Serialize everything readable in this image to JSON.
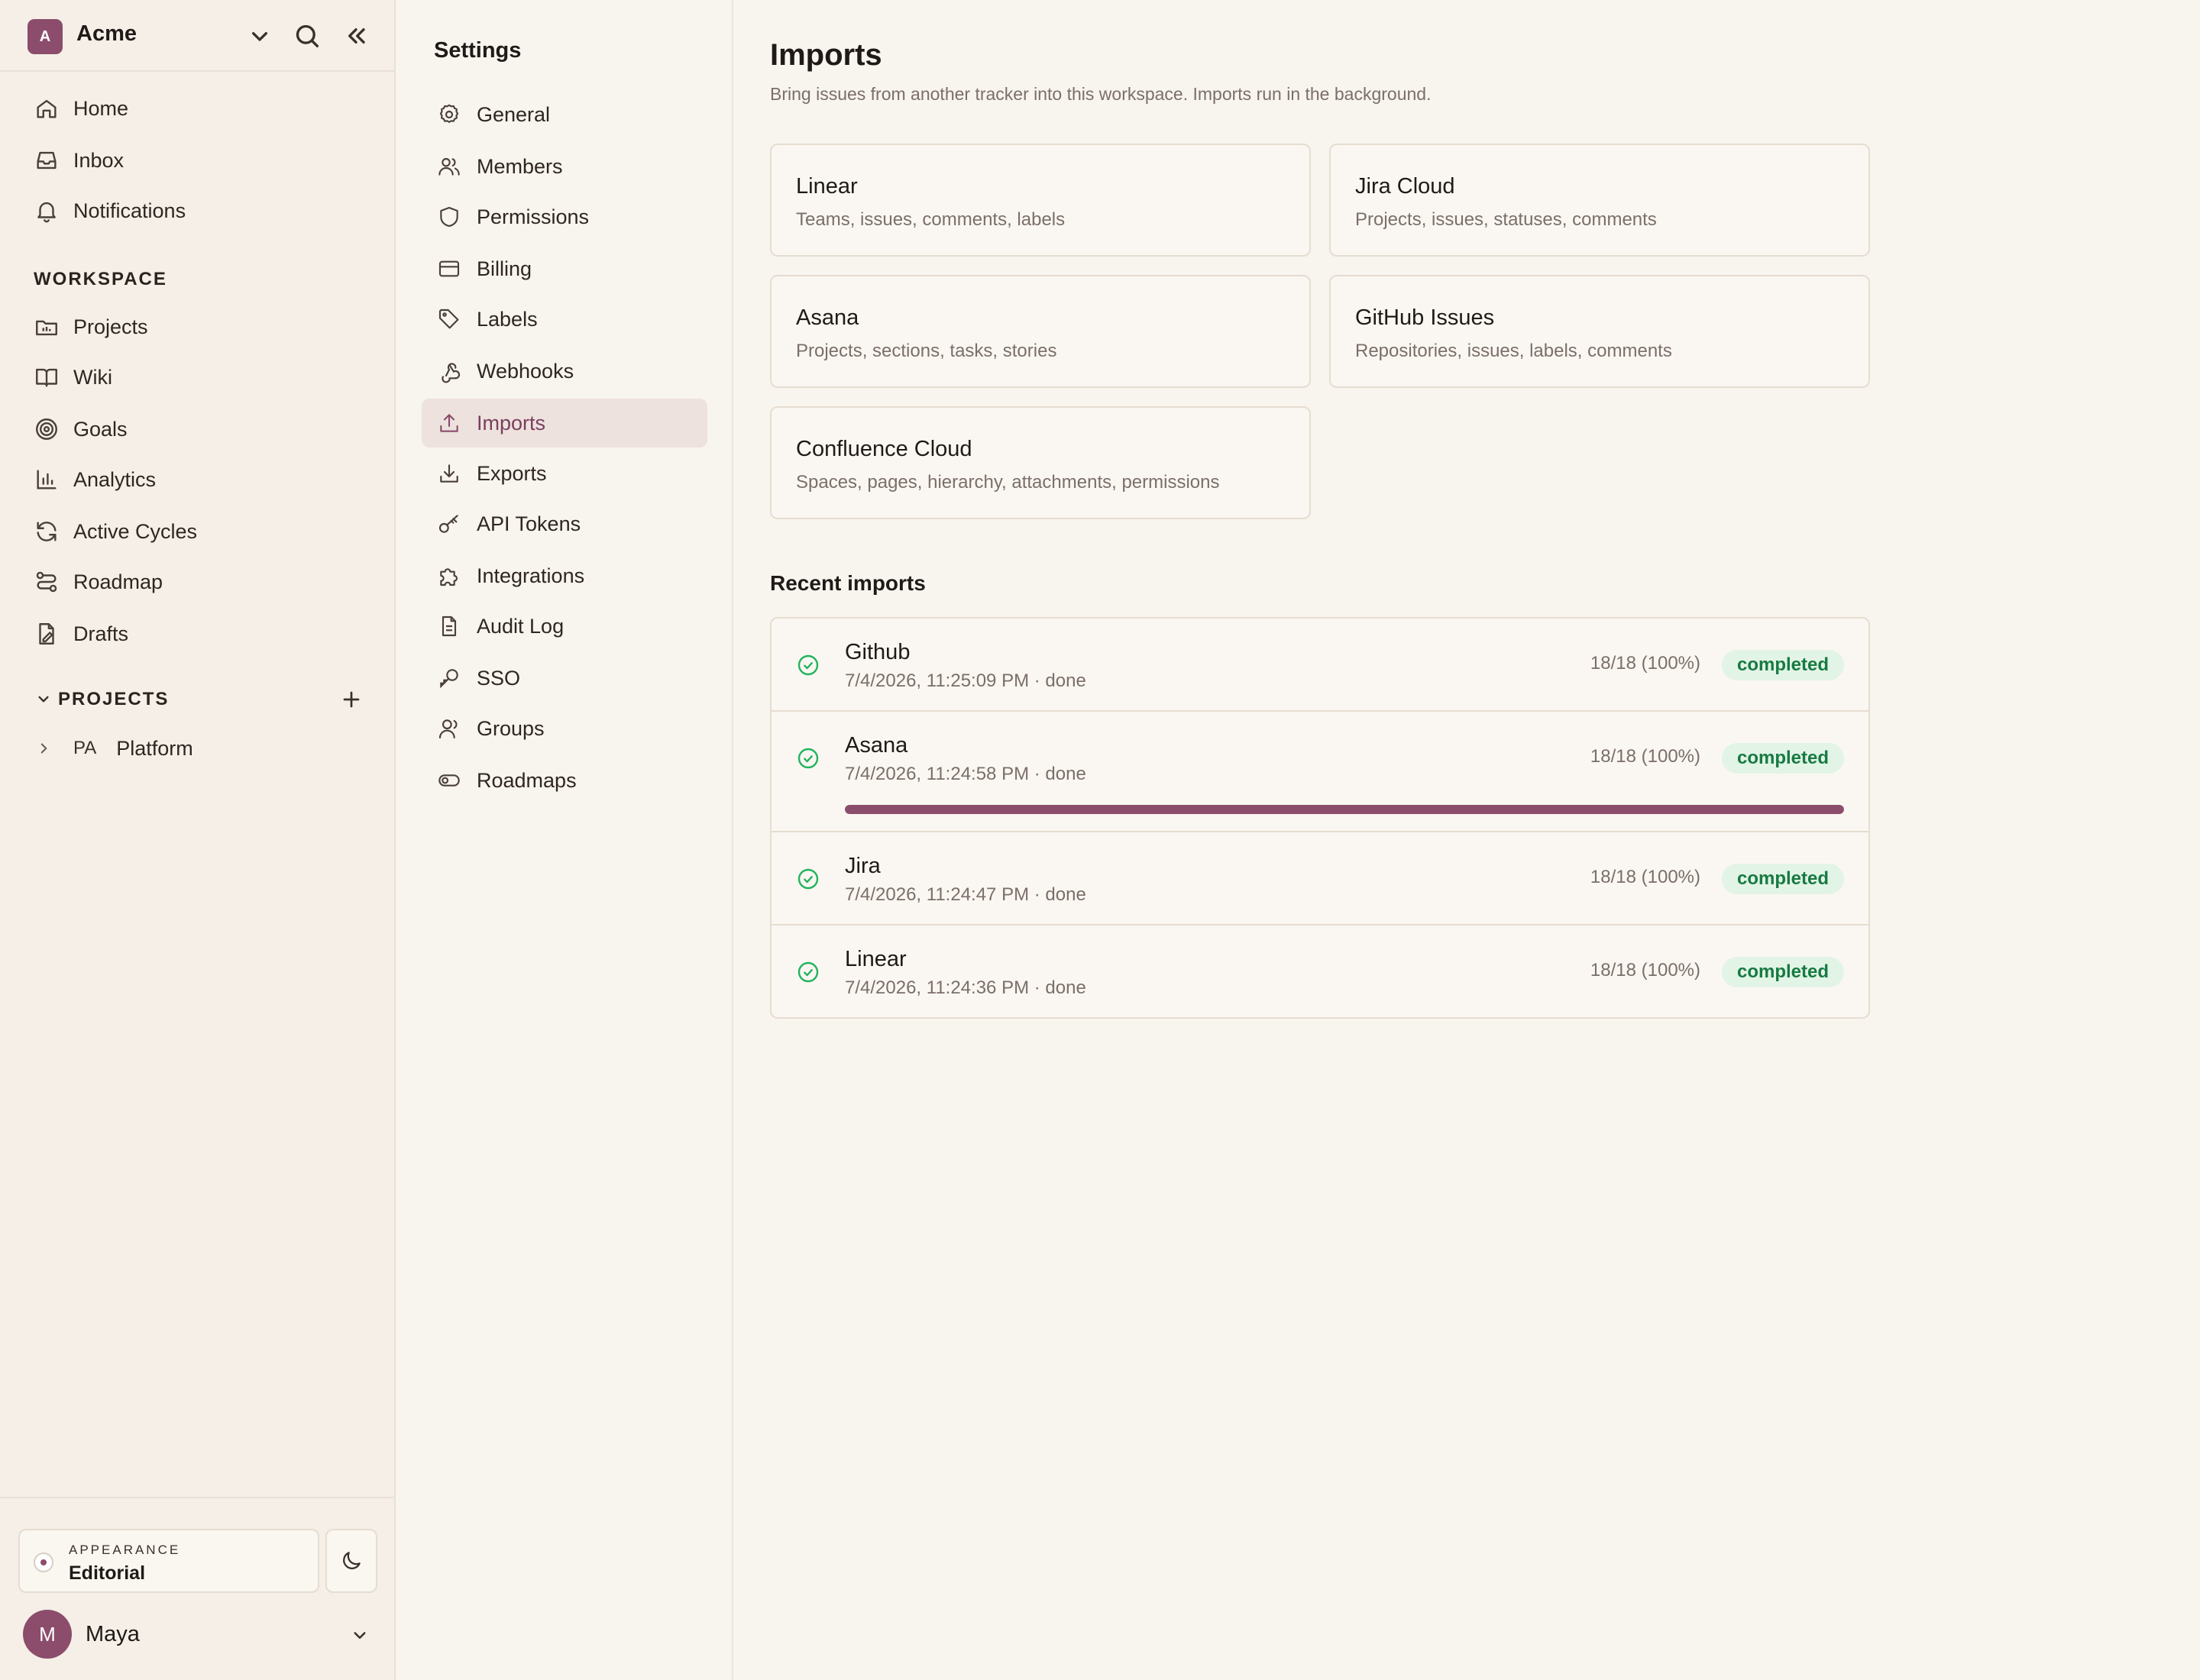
{
  "workspace": {
    "initial": "A",
    "name": "Acme"
  },
  "nav": {
    "primary": [
      {
        "label": "Home",
        "icon": "home-icon"
      },
      {
        "label": "Inbox",
        "icon": "inbox-icon"
      },
      {
        "label": "Notifications",
        "icon": "bell-icon"
      }
    ],
    "workspace_section": "WORKSPACE",
    "workspace_items": [
      {
        "label": "Projects",
        "icon": "projects-icon"
      },
      {
        "label": "Wiki",
        "icon": "book-icon"
      },
      {
        "label": "Goals",
        "icon": "target-icon"
      },
      {
        "label": "Analytics",
        "icon": "bar-chart-icon"
      },
      {
        "label": "Active Cycles",
        "icon": "refresh-icon"
      },
      {
        "label": "Roadmap",
        "icon": "route-icon"
      },
      {
        "label": "Drafts",
        "icon": "draft-icon"
      }
    ],
    "projects_section": "PROJECTS",
    "projects": [
      {
        "code": "PA",
        "label": "Platform"
      }
    ]
  },
  "appearance": {
    "label": "APPEARANCE",
    "value": "Editorial"
  },
  "user": {
    "initial": "M",
    "name": "Maya"
  },
  "settings": {
    "title": "Settings",
    "items": [
      {
        "label": "General",
        "icon": "gear-icon"
      },
      {
        "label": "Members",
        "icon": "users-icon"
      },
      {
        "label": "Permissions",
        "icon": "shield-icon"
      },
      {
        "label": "Billing",
        "icon": "credit-card-icon"
      },
      {
        "label": "Labels",
        "icon": "tag-icon"
      },
      {
        "label": "Webhooks",
        "icon": "webhook-icon"
      },
      {
        "label": "Imports",
        "icon": "upload-icon",
        "active": true
      },
      {
        "label": "Exports",
        "icon": "download-icon"
      },
      {
        "label": "API Tokens",
        "icon": "key-icon"
      },
      {
        "label": "Integrations",
        "icon": "puzzle-icon"
      },
      {
        "label": "Audit Log",
        "icon": "document-icon"
      },
      {
        "label": "SSO",
        "icon": "sso-key-icon"
      },
      {
        "label": "Groups",
        "icon": "group-icon"
      },
      {
        "label": "Roadmaps",
        "icon": "toggle-icon"
      }
    ]
  },
  "main": {
    "title": "Imports",
    "subtitle": "Bring issues from another tracker into this workspace. Imports run in the background.",
    "sources": [
      {
        "name": "Linear",
        "desc": "Teams, issues, comments, labels"
      },
      {
        "name": "Jira Cloud",
        "desc": "Projects, issues, statuses, comments"
      },
      {
        "name": "Asana",
        "desc": "Projects, sections, tasks, stories"
      },
      {
        "name": "GitHub Issues",
        "desc": "Repositories, issues, labels, comments"
      },
      {
        "name": "Confluence Cloud",
        "desc": "Spaces, pages, hierarchy, attachments, permissions"
      }
    ],
    "recent_title": "Recent imports",
    "imports": [
      {
        "name": "Github",
        "meta": "7/4/2026, 11:25:09 PM · done",
        "count": "18/18 (100%)",
        "status": "completed"
      },
      {
        "name": "Asana",
        "meta": "7/4/2026, 11:24:58 PM · done",
        "count": "18/18 (100%)",
        "status": "completed",
        "progress": 1.0
      },
      {
        "name": "Jira",
        "meta": "7/4/2026, 11:24:47 PM · done",
        "count": "18/18 (100%)",
        "status": "completed"
      },
      {
        "name": "Linear",
        "meta": "7/4/2026, 11:24:36 PM · done",
        "count": "18/18 (100%)",
        "status": "completed"
      }
    ]
  },
  "colors": {
    "accent": "#8b4d6b",
    "success": "#22b35e",
    "badge_bg": "#e2f4e6",
    "badge_text": "#177a42"
  }
}
